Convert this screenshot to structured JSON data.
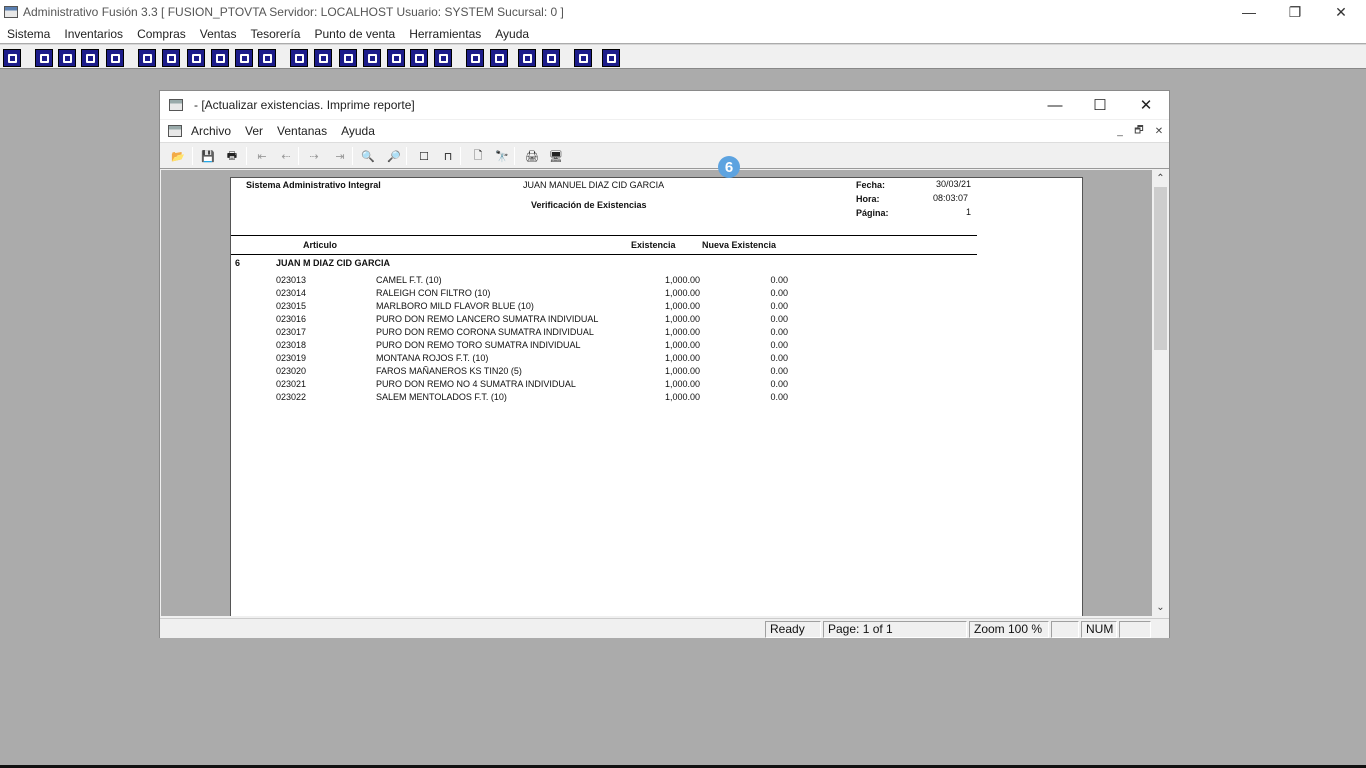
{
  "app": {
    "title": "Administrativo Fusión 3.3 [ FUSION_PTOVTA   Servidor: LOCALHOST   Usuario: SYSTEM     Sucursal: 0 ]",
    "menu": [
      "Sistema",
      "Inventarios",
      "Compras",
      "Ventas",
      "Tesorería",
      "Punto de venta",
      "Herramientas",
      "Ayuda"
    ],
    "window_controls": {
      "minimize": "—",
      "restore": "❐",
      "close": "✕"
    }
  },
  "child": {
    "title": "- [Actualizar existencias. Imprime reporte]",
    "menu": [
      "Archivo",
      "Ver",
      "Ventanas",
      "Ayuda"
    ],
    "window_controls": {
      "minimize": "—",
      "maximize": "☐",
      "close": "✕"
    },
    "mdi_controls": {
      "minimize": "_",
      "restore": "🗗",
      "close": "✕"
    }
  },
  "report": {
    "company": "Sistema Administrativo Integral",
    "owner": "JUAN MANUEL DIAZ CID GARCIA",
    "title": "Verificación de Existencias",
    "fecha_label": "Fecha:",
    "fecha": "30/03/21",
    "hora_label": "Hora:",
    "hora": "08:03:07",
    "pagina_label": "Página:",
    "pagina": "1",
    "col_articulo": "Articulo",
    "col_existencia": "Existencia",
    "col_nueva": "Nueva Existencia",
    "group_code": "6",
    "group_name": "JUAN M DIAZ CID GARCIA",
    "rows": [
      {
        "code": "023013",
        "desc": "CAMEL F.T. (10)",
        "exist": "1,000.00",
        "nueva": "0.00"
      },
      {
        "code": "023014",
        "desc": "RALEIGH CON FILTRO (10)",
        "exist": "1,000.00",
        "nueva": "0.00"
      },
      {
        "code": "023015",
        "desc": "MARLBORO MILD FLAVOR BLUE (10)",
        "exist": "1,000.00",
        "nueva": "0.00"
      },
      {
        "code": "023016",
        "desc": "PURO DON REMO LANCERO SUMATRA INDIVIDUAL",
        "exist": "1,000.00",
        "nueva": "0.00"
      },
      {
        "code": "023017",
        "desc": "PURO DON REMO CORONA SUMATRA INDIVIDUAL",
        "exist": "1,000.00",
        "nueva": "0.00"
      },
      {
        "code": "023018",
        "desc": "PURO DON REMO TORO SUMATRA INDIVIDUAL",
        "exist": "1,000.00",
        "nueva": "0.00"
      },
      {
        "code": "023019",
        "desc": "MONTANA ROJOS F.T. (10)",
        "exist": "1,000.00",
        "nueva": "0.00"
      },
      {
        "code": "023020",
        "desc": "FAROS MAÑANEROS KS TIN20 (5)",
        "exist": "1,000.00",
        "nueva": "0.00"
      },
      {
        "code": "023021",
        "desc": "PURO DON REMO NO 4 SUMATRA INDIVIDUAL",
        "exist": "1,000.00",
        "nueva": "0.00"
      },
      {
        "code": "023022",
        "desc": "SALEM MENTOLADOS F.T. (10)",
        "exist": "1,000.00",
        "nueva": "0.00"
      }
    ]
  },
  "status": {
    "ready": "Ready",
    "page": "Page: 1 of 1",
    "zoom": "Zoom 100 %",
    "num": "NUM"
  },
  "badge": "6"
}
